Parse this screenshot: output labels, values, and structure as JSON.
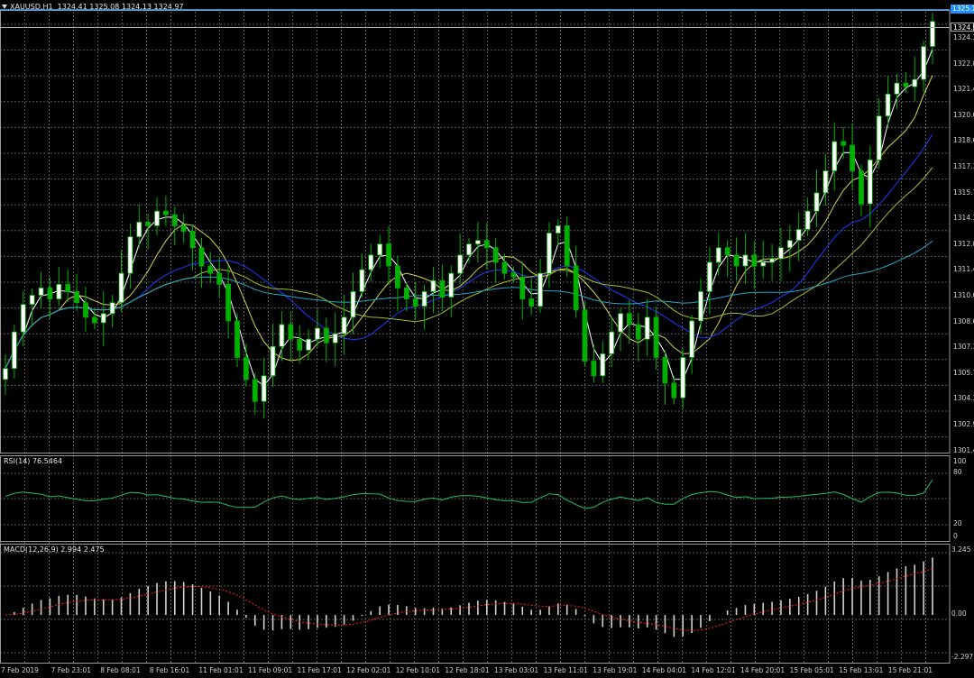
{
  "symbol_header": {
    "symbol": "XAUUSD,H1",
    "ohlc": "1324.41 1325.08 1324.13 1324.97"
  },
  "price_tags": {
    "ask": "1325.1",
    "bid": "1324.9"
  },
  "price_axis": [
    "1324.3",
    "1322.8",
    "1321.4",
    "1320.0",
    "1318.6",
    "1317.1",
    "1315.7",
    "1314.3",
    "1312.8",
    "1311.4",
    "1310.0",
    "1308.6",
    "1307.1",
    "1305.7",
    "1304.3",
    "1302.9",
    "1301.4"
  ],
  "rsi": {
    "label": "RSI(14) 76.5464",
    "levels": [
      "100",
      "80",
      "20",
      "0"
    ]
  },
  "macd": {
    "label": "MACD(12,26,9) 2.994 2.475",
    "levels": [
      "3.245",
      "0.00",
      "-2.297"
    ]
  },
  "time_axis": [
    "7 Feb 2019",
    "7 Feb 23:01",
    "8 Feb 08:01",
    "8 Feb 16:01",
    "11 Feb 01:01",
    "11 Feb 09:01",
    "11 Feb 17:01",
    "12 Feb 02:01",
    "12 Feb 10:01",
    "12 Feb 18:01",
    "13 Feb 03:01",
    "13 Feb 11:01",
    "13 Feb 19:01",
    "14 Feb 04:01",
    "14 Feb 12:01",
    "14 Feb 20:01",
    "15 Feb 05:01",
    "15 Feb 13:01",
    "15 Feb 21:01"
  ],
  "colors": {
    "background": "#000000",
    "grid": "#5a5a5a",
    "candle_bull": "#ffffff",
    "candle_bear": "#00b000",
    "ma_fast": "#ffffff",
    "ma_mid": "#d6d64a",
    "ma_slow": "#1a3cff",
    "ma_long": "#a0c020",
    "ma_200": "#20a8c8",
    "rsi_line": "#20c060",
    "macd_hist": "#d0d0d0",
    "macd_signal": "#ff2020",
    "ask_tag": "#1e90ff"
  },
  "chart_data": {
    "type": "candlestick",
    "price_range": [
      1301.4,
      1325.5
    ],
    "closes": [
      1306.0,
      1308.0,
      1309.5,
      1310.0,
      1310.4,
      1309.8,
      1310.6,
      1310.2,
      1309.6,
      1308.8,
      1308.5,
      1309.0,
      1309.6,
      1311.2,
      1313.2,
      1314.0,
      1313.8,
      1314.6,
      1314.4,
      1313.8,
      1313.5,
      1312.6,
      1311.6,
      1311.2,
      1310.6,
      1308.6,
      1306.6,
      1305.4,
      1304.2,
      1305.6,
      1307.2,
      1308.4,
      1307.6,
      1307.0,
      1307.6,
      1308.2,
      1307.4,
      1307.9,
      1308.8,
      1310.2,
      1311.4,
      1312.2,
      1312.8,
      1311.6,
      1310.4,
      1309.8,
      1309.4,
      1310.2,
      1310.8,
      1309.9,
      1311.2,
      1312.2,
      1312.8,
      1313.0,
      1312.6,
      1311.8,
      1311.2,
      1311.0,
      1309.8,
      1309.4,
      1311.2,
      1313.4,
      1313.8,
      1311.6,
      1309.2,
      1306.4,
      1305.6,
      1306.8,
      1308.0,
      1309.0,
      1308.4,
      1307.6,
      1308.8,
      1306.6,
      1305.2,
      1304.4,
      1306.6,
      1308.6,
      1310.2,
      1311.8,
      1312.6,
      1312.2,
      1311.6,
      1312.2,
      1311.6,
      1311.8,
      1312.0,
      1312.6,
      1313.0,
      1313.6,
      1314.6,
      1315.6,
      1316.8,
      1318.4,
      1318.2,
      1316.8,
      1315.0,
      1317.4,
      1319.8,
      1321.0,
      1321.6,
      1321.4,
      1321.8,
      1323.6,
      1324.97
    ],
    "rsi_range": [
      0,
      100
    ],
    "rsi_levels": [
      80,
      20
    ],
    "macd_range": [
      -2.297,
      3.245
    ],
    "macd_last": 2.994,
    "signal_last": 2.475
  }
}
